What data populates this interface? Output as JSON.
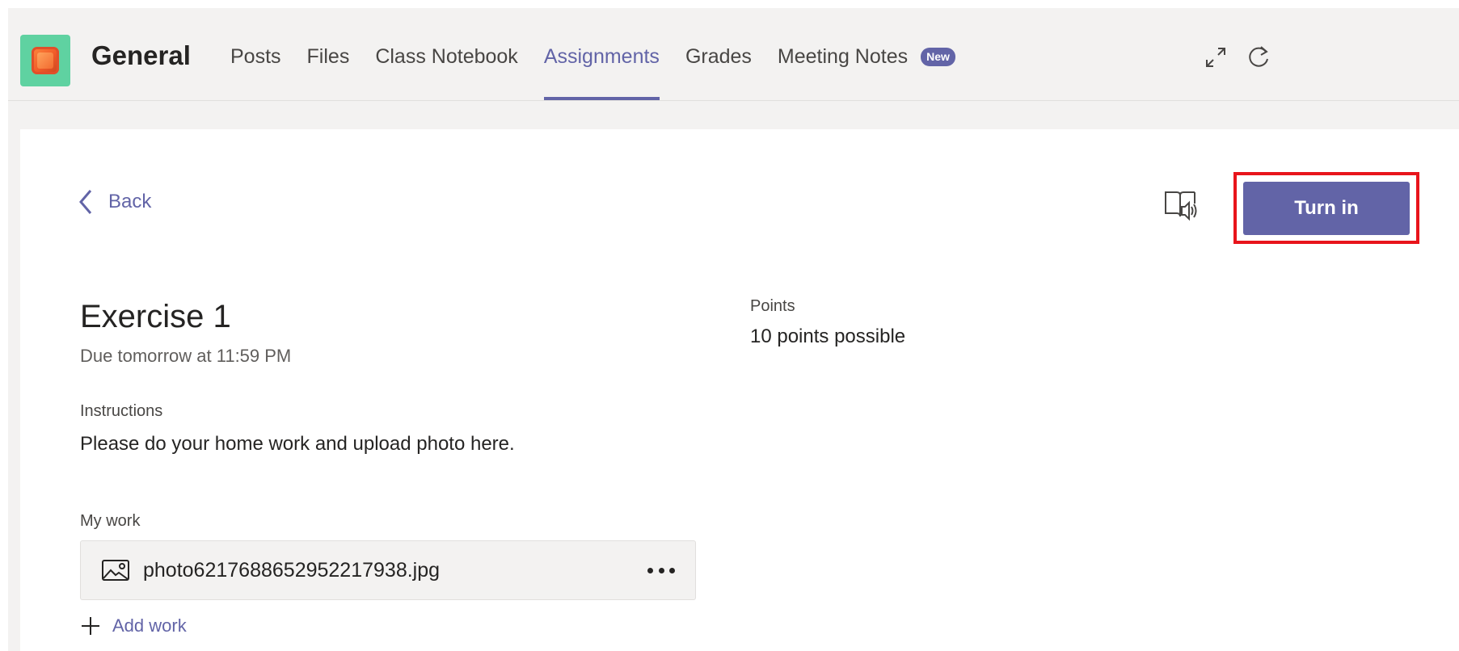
{
  "header": {
    "channel_name": "General",
    "tabs": [
      {
        "label": "Posts",
        "active": false
      },
      {
        "label": "Files",
        "active": false
      },
      {
        "label": "Class Notebook",
        "active": false
      },
      {
        "label": "Assignments",
        "active": true
      },
      {
        "label": "Grades",
        "active": false
      },
      {
        "label": "Meeting Notes",
        "active": false,
        "badge": "New"
      }
    ],
    "icons": [
      "expand-icon",
      "refresh-icon"
    ]
  },
  "toolbar": {
    "back_label": "Back",
    "turn_in_label": "Turn in",
    "immersive_reader_icon": "immersive-reader-icon"
  },
  "assignment": {
    "title": "Exercise 1",
    "due": "Due tomorrow at 11:59 PM",
    "instructions_label": "Instructions",
    "instructions_text": "Please do your home work and upload photo here.",
    "points_label": "Points",
    "points_value": "10 points possible"
  },
  "my_work": {
    "label": "My work",
    "files": [
      {
        "name": "photo6217688652952217938.jpg",
        "icon": "image-file-icon"
      }
    ],
    "add_work_label": "Add work"
  },
  "colors": {
    "accent": "#6264a7",
    "highlight": "#e8141b",
    "team_avatar_bg": "#5fd2a1",
    "header_bg": "#f3f2f1"
  }
}
